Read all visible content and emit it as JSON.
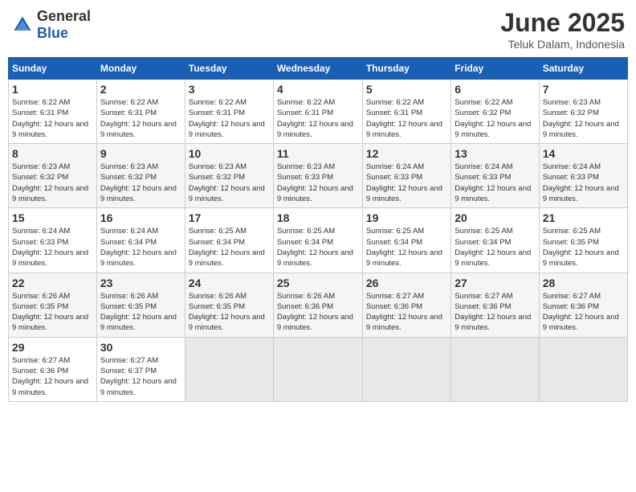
{
  "logo": {
    "general": "General",
    "blue": "Blue"
  },
  "title": "June 2025",
  "subtitle": "Teluk Dalam, Indonesia",
  "headers": [
    "Sunday",
    "Monday",
    "Tuesday",
    "Wednesday",
    "Thursday",
    "Friday",
    "Saturday"
  ],
  "weeks": [
    [
      {
        "day": "1",
        "sunrise": "6:22 AM",
        "sunset": "6:31 PM",
        "daylight": "12 hours and 9 minutes."
      },
      {
        "day": "2",
        "sunrise": "6:22 AM",
        "sunset": "6:31 PM",
        "daylight": "12 hours and 9 minutes."
      },
      {
        "day": "3",
        "sunrise": "6:22 AM",
        "sunset": "6:31 PM",
        "daylight": "12 hours and 9 minutes."
      },
      {
        "day": "4",
        "sunrise": "6:22 AM",
        "sunset": "6:31 PM",
        "daylight": "12 hours and 9 minutes."
      },
      {
        "day": "5",
        "sunrise": "6:22 AM",
        "sunset": "6:31 PM",
        "daylight": "12 hours and 9 minutes."
      },
      {
        "day": "6",
        "sunrise": "6:22 AM",
        "sunset": "6:32 PM",
        "daylight": "12 hours and 9 minutes."
      },
      {
        "day": "7",
        "sunrise": "6:23 AM",
        "sunset": "6:32 PM",
        "daylight": "12 hours and 9 minutes."
      }
    ],
    [
      {
        "day": "8",
        "sunrise": "6:23 AM",
        "sunset": "6:32 PM",
        "daylight": "12 hours and 9 minutes."
      },
      {
        "day": "9",
        "sunrise": "6:23 AM",
        "sunset": "6:32 PM",
        "daylight": "12 hours and 9 minutes."
      },
      {
        "day": "10",
        "sunrise": "6:23 AM",
        "sunset": "6:32 PM",
        "daylight": "12 hours and 9 minutes."
      },
      {
        "day": "11",
        "sunrise": "6:23 AM",
        "sunset": "6:33 PM",
        "daylight": "12 hours and 9 minutes."
      },
      {
        "day": "12",
        "sunrise": "6:24 AM",
        "sunset": "6:33 PM",
        "daylight": "12 hours and 9 minutes."
      },
      {
        "day": "13",
        "sunrise": "6:24 AM",
        "sunset": "6:33 PM",
        "daylight": "12 hours and 9 minutes."
      },
      {
        "day": "14",
        "sunrise": "6:24 AM",
        "sunset": "6:33 PM",
        "daylight": "12 hours and 9 minutes."
      }
    ],
    [
      {
        "day": "15",
        "sunrise": "6:24 AM",
        "sunset": "6:33 PM",
        "daylight": "12 hours and 9 minutes."
      },
      {
        "day": "16",
        "sunrise": "6:24 AM",
        "sunset": "6:34 PM",
        "daylight": "12 hours and 9 minutes."
      },
      {
        "day": "17",
        "sunrise": "6:25 AM",
        "sunset": "6:34 PM",
        "daylight": "12 hours and 9 minutes."
      },
      {
        "day": "18",
        "sunrise": "6:25 AM",
        "sunset": "6:34 PM",
        "daylight": "12 hours and 9 minutes."
      },
      {
        "day": "19",
        "sunrise": "6:25 AM",
        "sunset": "6:34 PM",
        "daylight": "12 hours and 9 minutes."
      },
      {
        "day": "20",
        "sunrise": "6:25 AM",
        "sunset": "6:34 PM",
        "daylight": "12 hours and 9 minutes."
      },
      {
        "day": "21",
        "sunrise": "6:25 AM",
        "sunset": "6:35 PM",
        "daylight": "12 hours and 9 minutes."
      }
    ],
    [
      {
        "day": "22",
        "sunrise": "6:26 AM",
        "sunset": "6:35 PM",
        "daylight": "12 hours and 9 minutes."
      },
      {
        "day": "23",
        "sunrise": "6:26 AM",
        "sunset": "6:35 PM",
        "daylight": "12 hours and 9 minutes."
      },
      {
        "day": "24",
        "sunrise": "6:26 AM",
        "sunset": "6:35 PM",
        "daylight": "12 hours and 9 minutes."
      },
      {
        "day": "25",
        "sunrise": "6:26 AM",
        "sunset": "6:36 PM",
        "daylight": "12 hours and 9 minutes."
      },
      {
        "day": "26",
        "sunrise": "6:27 AM",
        "sunset": "6:36 PM",
        "daylight": "12 hours and 9 minutes."
      },
      {
        "day": "27",
        "sunrise": "6:27 AM",
        "sunset": "6:36 PM",
        "daylight": "12 hours and 9 minutes."
      },
      {
        "day": "28",
        "sunrise": "6:27 AM",
        "sunset": "6:36 PM",
        "daylight": "12 hours and 9 minutes."
      }
    ],
    [
      {
        "day": "29",
        "sunrise": "6:27 AM",
        "sunset": "6:36 PM",
        "daylight": "12 hours and 9 minutes."
      },
      {
        "day": "30",
        "sunrise": "6:27 AM",
        "sunset": "6:37 PM",
        "daylight": "12 hours and 9 minutes."
      },
      null,
      null,
      null,
      null,
      null
    ]
  ]
}
